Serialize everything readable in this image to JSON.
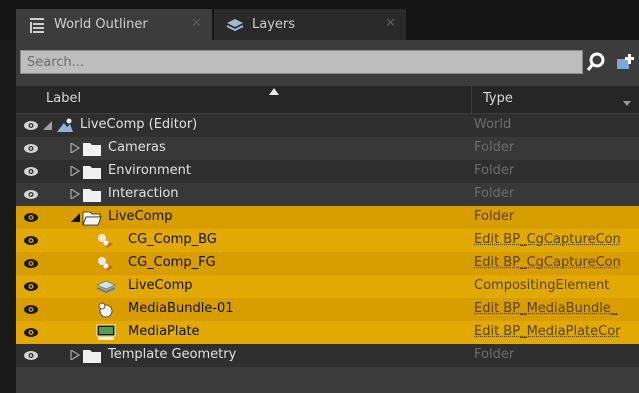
{
  "tabs": [
    {
      "label": "World Outliner",
      "icon": "list-icon",
      "active": true
    },
    {
      "label": "Layers",
      "icon": "layers-icon",
      "active": false
    }
  ],
  "search": {
    "placeholder": "Search..."
  },
  "columns": {
    "label": "Label",
    "type": "Type"
  },
  "rows": [
    {
      "label": "LiveComp (Editor)",
      "type": "World",
      "icon": "world-icon",
      "expander": "expanded",
      "selected": false
    },
    {
      "label": "Cameras",
      "type": "Folder",
      "icon": "folder-icon",
      "expander": "collapsed",
      "selected": false
    },
    {
      "label": "Environment",
      "type": "Folder",
      "icon": "folder-icon",
      "expander": "collapsed",
      "selected": false
    },
    {
      "label": "Interaction",
      "type": "Folder",
      "icon": "folder-icon",
      "expander": "collapsed",
      "selected": false
    },
    {
      "label": "LiveComp",
      "type": "Folder",
      "icon": "open-folder-icon",
      "expander": "expanded",
      "selected": true
    },
    {
      "label": "CG_Comp_BG",
      "type": "Edit BP_CgCaptureCon",
      "icon": "cg-capture-icon",
      "expander": "none",
      "selected": true
    },
    {
      "label": "CG_Comp_FG",
      "type": "Edit BP_CgCaptureCon",
      "icon": "cg-capture-icon",
      "expander": "none",
      "selected": true
    },
    {
      "label": "LiveComp",
      "type": "CompositingElement",
      "icon": "compositing-layers-icon",
      "expander": "none",
      "selected": true
    },
    {
      "label": "MediaBundle-01",
      "type": "Edit BP_MediaBundle_",
      "icon": "media-bundle-icon",
      "expander": "none",
      "selected": true
    },
    {
      "label": "MediaPlate",
      "type": "Edit BP_MediaPlateCor",
      "icon": "media-plate-icon",
      "expander": "none",
      "selected": true
    },
    {
      "label": "Template Geometry",
      "type": "Folder",
      "icon": "folder-icon",
      "expander": "collapsed",
      "selected": false
    }
  ],
  "colors": {
    "selection": "#d89e00",
    "panel": "#3c3c3c",
    "header": "#262626"
  }
}
